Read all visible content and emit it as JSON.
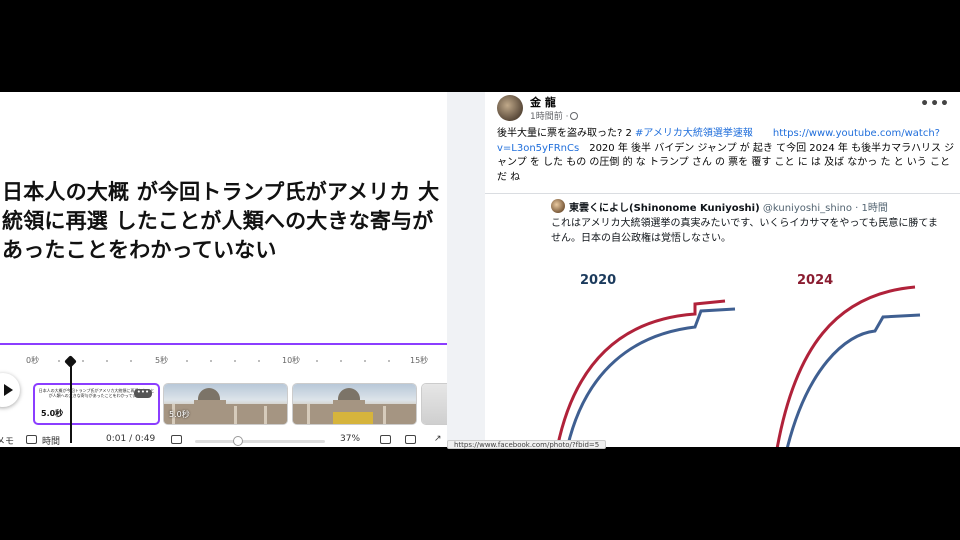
{
  "editor": {
    "headline": "日本人の大概 が今回トランプ氏がアメリカ 大統領に再選 したことが人類への大きな寄与があったことをわかっていない",
    "ruler_ticks": [
      "0秒",
      "5秒",
      "10秒",
      "15秒"
    ],
    "text_clip": {
      "mini_text": "日本人の大概が今回トランプ氏がアメリカ大統領に再選したことが人類への大きな寄与があったことをわかっていない",
      "duration": "5.0秒",
      "more_label": "•••"
    },
    "image_clip": {
      "duration": "5.0秒"
    },
    "toolbar": {
      "notes_label": "メモ",
      "timer_label": "時間",
      "time_display": "0:01 / 0:49",
      "zoom_label": "37%"
    }
  },
  "facebook": {
    "author": "金 龍",
    "time": "1時間前 ·",
    "menu": "•••",
    "post_text_before": "後半大量に票を盗み取った? 2 ",
    "hashtag": "#アメリカ大統領選挙速報",
    "url": "https://www.youtube.com/watch?v=L3on5yFRnCs",
    "post_text_after": "　2020 年 後半 バイデン ジャンプ が 起き て今回 2024 年 も後半カマラハリス ジャンプ を した もの の圧倒 的 な トランプ さん の 票を 覆す こと に は 及ば なかっ た と いう こと だ ね",
    "quote": {
      "name": "東雲くによし(Shinonome Kuniyoshi)",
      "handle": "@kuniyoshi_shino",
      "time": "· 1時間",
      "text": "これはアメリカ大統領選挙の真実みたいです、いくらイカサマをやっても民意に勝てません。日本の自公政権は覚悟しなさい。",
      "years": [
        "2020",
        "2024"
      ]
    }
  },
  "status_url": "https://www.facebook.com/photo/?fbid=5",
  "colors": {
    "accent": "#8b3dff",
    "fb_link": "#216fdb",
    "red": "#b0223a",
    "blue": "#3f5f91"
  }
}
